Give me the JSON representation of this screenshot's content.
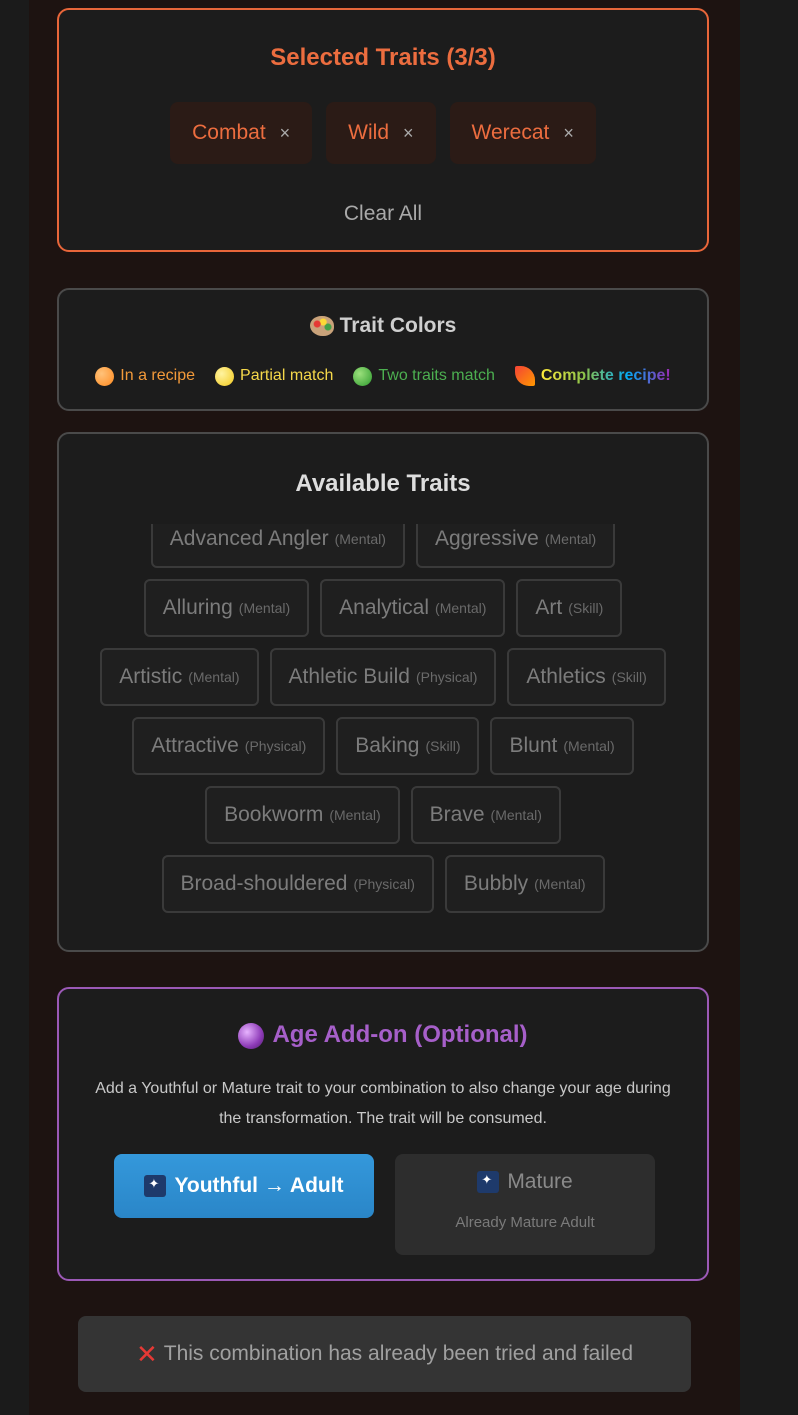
{
  "selected": {
    "title": "Selected Traits (3/3)",
    "chips": [
      "Combat",
      "Wild",
      "Werecat"
    ],
    "remove_glyph": "×",
    "clear_label": "Clear All"
  },
  "legend": {
    "title": "Trait Colors",
    "items": [
      {
        "label": "In a recipe",
        "color": "#ff9a3c"
      },
      {
        "label": "Partial match",
        "color": "#f5d84a"
      },
      {
        "label": "Two traits match",
        "color": "#4caf50"
      },
      {
        "label": "Complete recipe!",
        "color": "gradient"
      }
    ]
  },
  "available": {
    "title": "Available Traits",
    "traits": [
      {
        "name": "Advanced Angler",
        "cat": "(Mental)"
      },
      {
        "name": "Aggressive",
        "cat": "(Mental)"
      },
      {
        "name": "Alluring",
        "cat": "(Mental)"
      },
      {
        "name": "Analytical",
        "cat": "(Mental)"
      },
      {
        "name": "Art",
        "cat": "(Skill)"
      },
      {
        "name": "Artistic",
        "cat": "(Mental)"
      },
      {
        "name": "Athletic Build",
        "cat": "(Physical)"
      },
      {
        "name": "Athletics",
        "cat": "(Skill)"
      },
      {
        "name": "Attractive",
        "cat": "(Physical)"
      },
      {
        "name": "Baking",
        "cat": "(Skill)"
      },
      {
        "name": "Blunt",
        "cat": "(Mental)"
      },
      {
        "name": "Bookworm",
        "cat": "(Mental)"
      },
      {
        "name": "Brave",
        "cat": "(Mental)"
      },
      {
        "name": "Broad-shouldered",
        "cat": "(Physical)"
      },
      {
        "name": "Bubbly",
        "cat": "(Mental)"
      }
    ]
  },
  "age": {
    "title": "Age Add-on (Optional)",
    "description": "Add a Youthful or Mature trait to your combination to also change your age during the transformation. The trait will be consumed.",
    "youthful_label": "Youthful → Adult",
    "mature_label": "Mature",
    "mature_sub": "Already Mature Adult"
  },
  "status": {
    "failed_message": "This combination has already been tried and failed"
  },
  "colors": {
    "accent": "#ec6d3f",
    "age_accent": "#a65fc9",
    "youthful_button": "#3498db"
  }
}
